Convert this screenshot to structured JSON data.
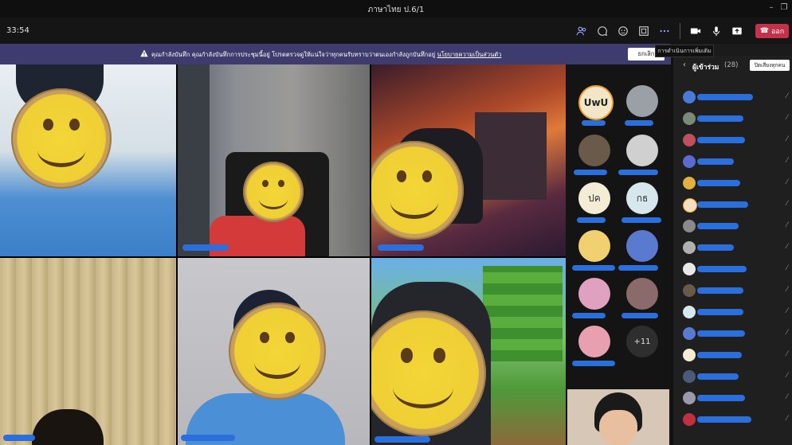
{
  "window": {
    "title": "ภาษาไทย ป.6/1"
  },
  "toolbar": {
    "timer": "33:54",
    "leave_label": "ออก",
    "more_tooltip": "การดำเนินการเพิ่มเติม",
    "icons": [
      "people-icon",
      "chat-icon",
      "reactions-icon",
      "rooms-icon",
      "more-icon",
      "camera-icon",
      "mic-icon",
      "share-icon"
    ]
  },
  "banner": {
    "message": "คุณกำลังบันทึก คุณกำลังบันทึกการประชุมนี้อยู่ โปรดตรวจดูให้แน่ใจว่าทุกคนรับทราบว่าตนเองกำลังถูกบันทึกอยู่",
    "link": "นโยบายความเป็นส่วนตัว",
    "dismiss_label": "ยกเลิก"
  },
  "gallery": {
    "overflow_label": "+11",
    "initials": [
      "ปค",
      "กธ"
    ]
  },
  "participants_panel": {
    "title": "ผู้เข้าร่วม",
    "count": "(28)",
    "mute_all_label": "ปิดเสียงทุกคน"
  },
  "colors": {
    "banner": "#3e3c6e",
    "leave": "#c4314b",
    "name_redaction": "#2a6fdb"
  }
}
